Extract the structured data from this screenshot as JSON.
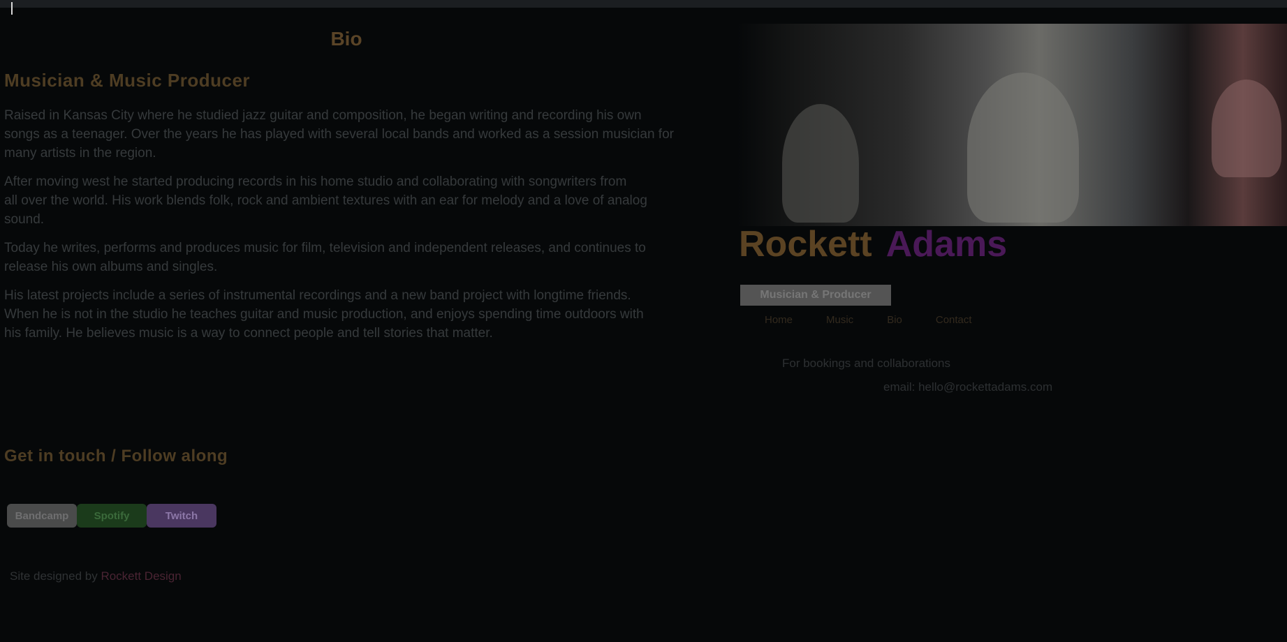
{
  "window": {
    "title": ""
  },
  "left": {
    "section_heading": "Bio",
    "sub_heading": "Musician & Music Producer",
    "bio_paragraphs": [
      "Raised in Kansas City where he studied jazz guitar and composition, he began writing and recording his own",
      "songs as a teenager. Over the years he has played with several local bands and worked as a session musician for",
      "many artists in the region.",
      "After moving west he started producing records in his home studio and collaborating with songwriters from",
      "all over the world. His work blends folk, rock and ambient textures with an ear for melody and a love of analog",
      "sound.",
      "Today he writes, performs and produces music for film, television and independent releases, and continues to",
      "release his own albums and singles.",
      "His latest projects include a series of instrumental recordings and a new band project with longtime friends.",
      "When he is not in the studio he teaches guitar and music production, and enjoys spending time outdoors with",
      "his family. He believes music is a way to connect people and tell stories that matter."
    ],
    "sub_heading_2": "Get in touch / Follow along",
    "badges": [
      "Bandcamp",
      "Spotify",
      "Twitch"
    ],
    "credit_prefix": "Site designed by",
    "credit_link": "Rockett Design"
  },
  "right": {
    "name_first": "Rockett",
    "name_last": "Adams",
    "tagline": "Musician & Producer",
    "links": [
      "Home",
      "Music",
      "Bio",
      "Contact"
    ],
    "contact_lines": [
      "For bookings and collaborations",
      "email: hello@rockettadams.com"
    ]
  },
  "colors": {
    "background": "#060809",
    "accent_gold": "#5b4323",
    "accent_purple": "#4a1957"
  }
}
